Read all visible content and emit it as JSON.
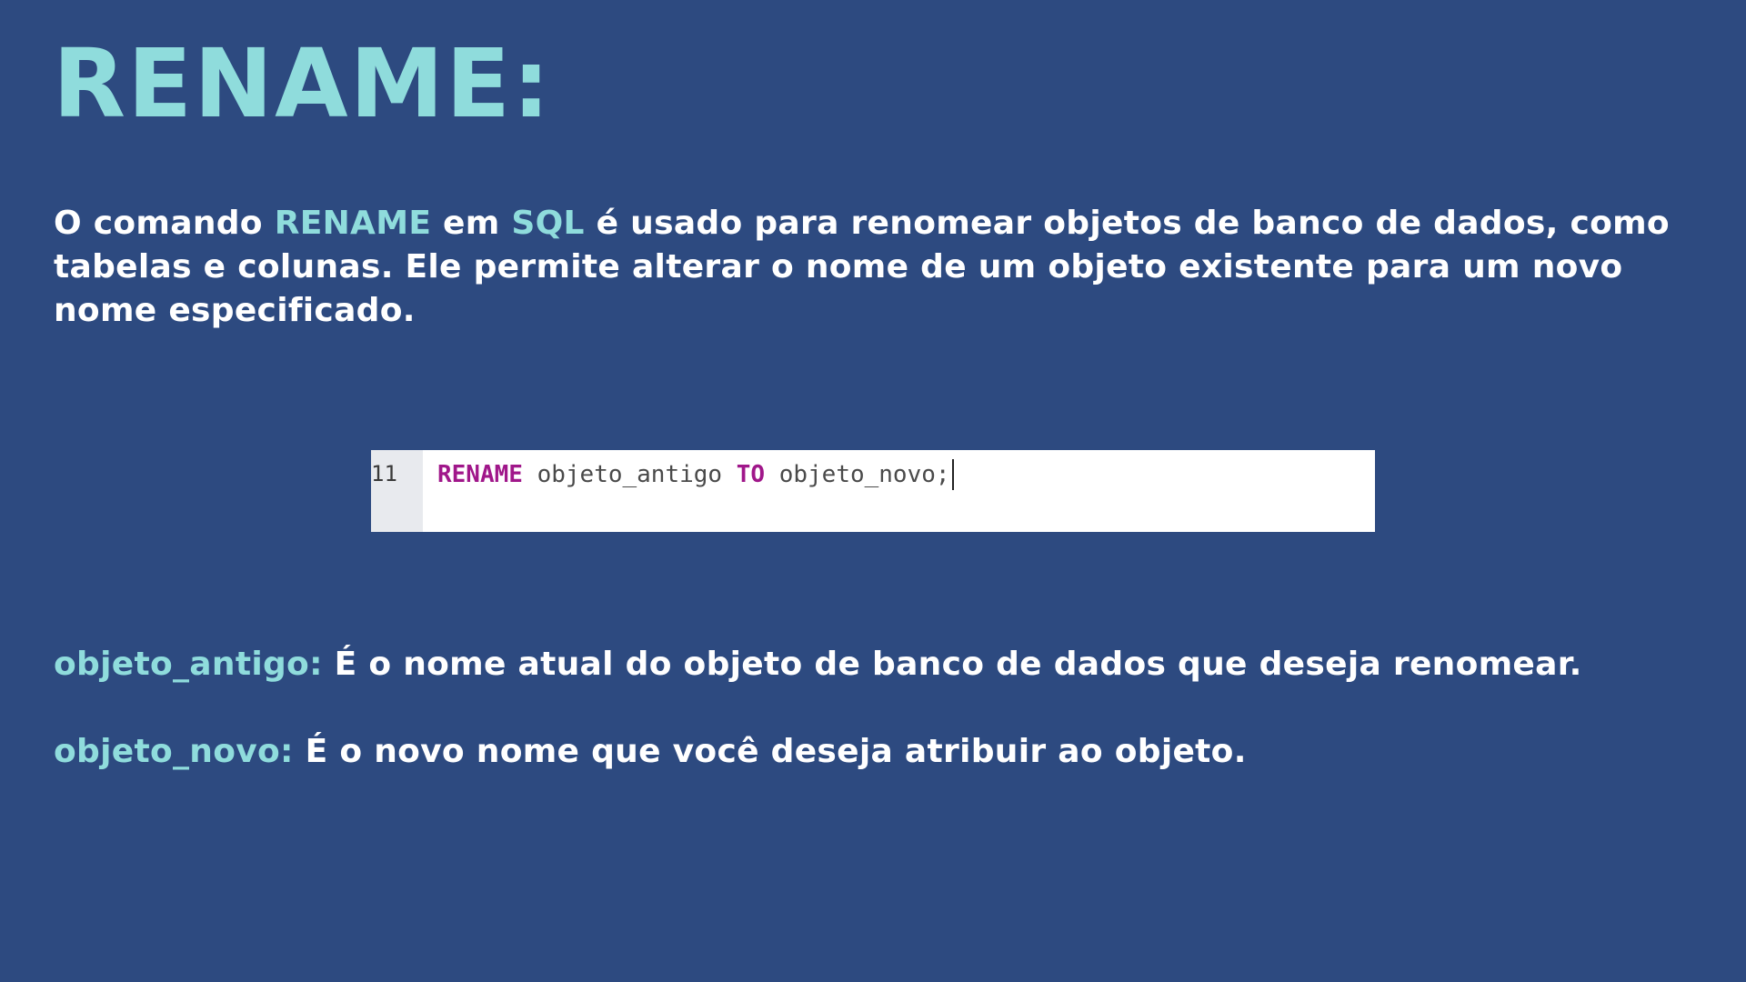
{
  "title": "RENAME:",
  "intro": {
    "part1": "O comando ",
    "keyword1": "RENAME",
    "part2": " em ",
    "keyword2": "SQL",
    "part3": " é usado para renomear objetos de banco de dados, como tabelas e colunas. Ele permite alterar o nome de um objeto existente para um novo nome especificado."
  },
  "code": {
    "line_number": "11",
    "keyword_rename": "RENAME",
    "old_name": " objeto_antigo ",
    "keyword_to": "TO",
    "new_name": " objeto_novo;"
  },
  "definitions": [
    {
      "term": "objeto_antigo:",
      "description": " É o nome atual do objeto de banco de dados que deseja renomear."
    },
    {
      "term": "objeto_novo:",
      "description": " É o novo nome que você deseja atribuir ao objeto."
    }
  ],
  "colors": {
    "background": "#2d4a80",
    "accent": "#8fdcdc",
    "text": "#ffffff",
    "sql_keyword": "#a0178a"
  }
}
